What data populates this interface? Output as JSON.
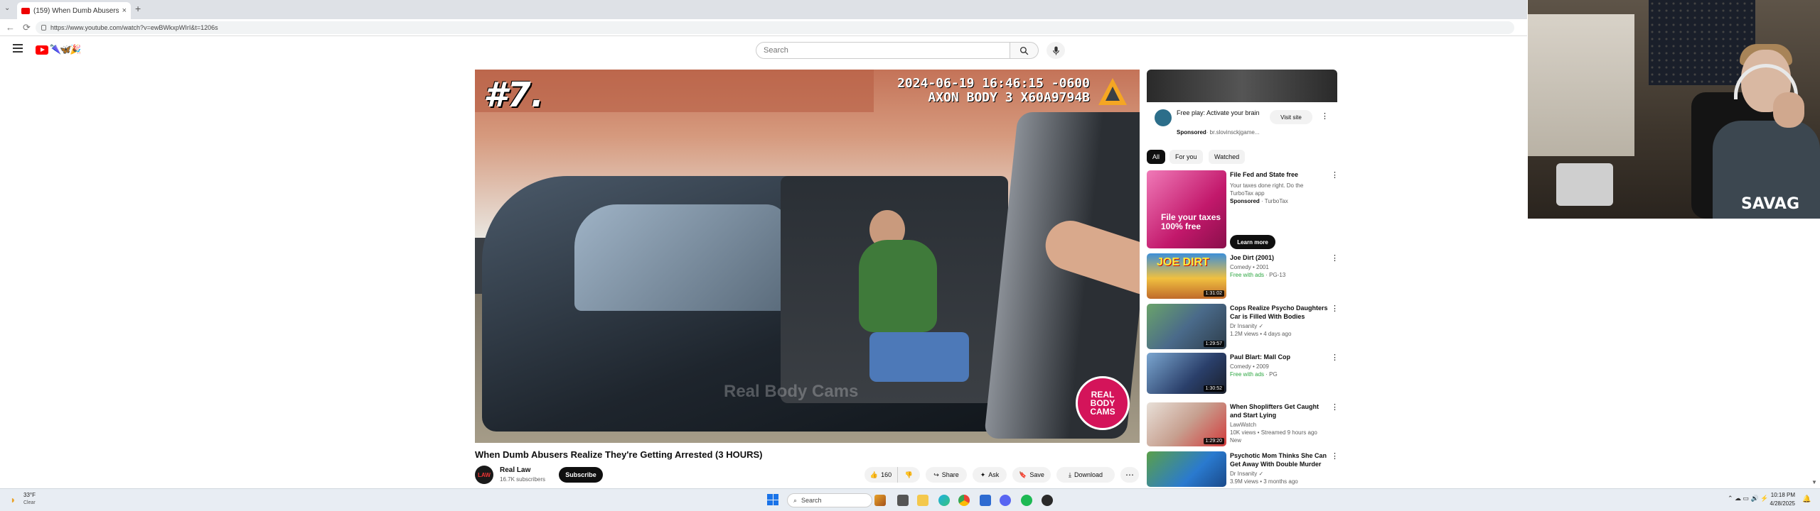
{
  "browser": {
    "tab_title": "(159) When Dumb Abusers",
    "tab_close": "×",
    "new_tab": "+",
    "tab_list": "⌄",
    "url": "https://www.youtube.com/watch?v=ewBWkxpWIrI&t=1206s",
    "back": "←",
    "reload": "⟳"
  },
  "header": {
    "search_placeholder": "Search",
    "doodle": "🌂🦋🎉"
  },
  "player": {
    "episode_number": "#7.",
    "timestamp_line1": "2024-06-19 16:46:15 -0600",
    "timestamp_line2": "AXON BODY 3 X60A9794B",
    "watermark": "Real Body Cams",
    "overlay_logo": "REAL BODY CAMS"
  },
  "video": {
    "title": "When Dumb Abusers Realize They're Getting Arrested (3 HOURS)",
    "channel_name": "Real Law",
    "channel_subscribers": "16.7K subscribers",
    "channel_avatar_text": "LAW",
    "subscribe_label": "Subscribe",
    "like_count": "160",
    "share_label": "Share",
    "ask_label": "Ask",
    "save_label": "Save",
    "download_label": "Download",
    "more_label": "⋯"
  },
  "sidebar": {
    "ad": {
      "title": "Free play: Activate your brain",
      "sponsored": "Sponsored",
      "domain": "· br.slovinsckjgame...",
      "visit_label": "Visit site"
    },
    "chips": [
      "All",
      "For you",
      "Watched"
    ],
    "recommendations": [
      {
        "title": "File Fed and State free",
        "line2": "Your taxes done right. Do the",
        "line3": "TurboTax app",
        "line4_sponsored": "Sponsored",
        "line4_rest": " · TurboTax",
        "thumb_text": "File your taxes 100% free",
        "cta": "Learn more"
      },
      {
        "title": "Joe Dirt (2001)",
        "line2": "Comedy • 2001",
        "line3_green": "Free with ads",
        "line3_rest": " · PG-13",
        "thumb_text": "JOE DIRT",
        "duration": "1:31:02"
      },
      {
        "title": "Cops Realize Psycho Daughters Car is Filled With Bodies",
        "line2": "Dr Insanity ✓",
        "line3": "1.2M views • 4 days ago",
        "duration": "1:29:57"
      },
      {
        "title": "Paul Blart: Mall Cop",
        "line2": "Comedy • 2009",
        "line3_green": "Free with ads",
        "line3_rest": " · PG",
        "duration": "1:30:52"
      },
      {
        "title": "When Shoplifters Get Caught and Start Lying",
        "line2": "LawWatch",
        "line3": "10K views • Streamed 9 hours ago",
        "line4": "New",
        "duration": "1:29:20"
      },
      {
        "title": "Psychotic Mom Thinks She Can Get Away With Double Murder",
        "line2": "Dr Insanity ✓",
        "line3": "3.9M views • 3 months ago"
      }
    ]
  },
  "webcam": {
    "shirt_text": "SAVAG"
  },
  "taskbar": {
    "weather_temp": "33°F",
    "weather_condition": "Clear",
    "search_label": "Search",
    "time": "10:18 PM",
    "date": "4/28/2025",
    "tray_icons": "⌃ ☁ ▭ 🔊 ⚡"
  },
  "colors": {
    "youtube_red": "#ff0000",
    "accent_dark": "#0f0f0f",
    "free_with_ads": "#2ba640"
  }
}
